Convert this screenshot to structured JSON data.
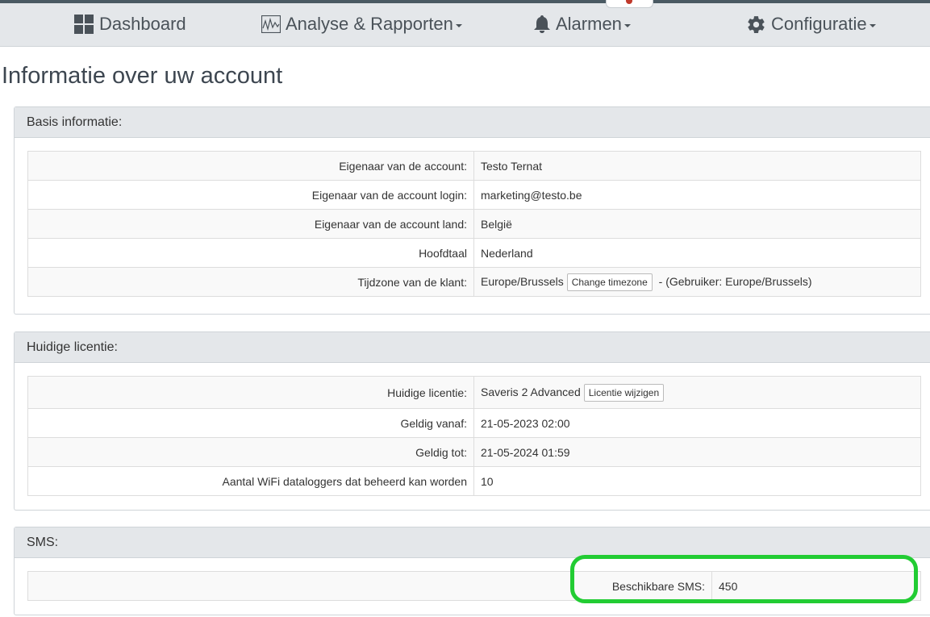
{
  "nav": {
    "dashboard": "Dashboard",
    "analyse": "Analyse & Rapporten",
    "alarmen": "Alarmen",
    "configuratie": "Configuratie"
  },
  "page_title": "Informatie over uw account",
  "basis": {
    "heading": "Basis informatie:",
    "rows": [
      {
        "label": "Eigenaar van de account:",
        "value": "Testo Ternat"
      },
      {
        "label": "Eigenaar van de account login:",
        "value": "marketing@testo.be"
      },
      {
        "label": "Eigenaar van de account land:",
        "value": "België"
      },
      {
        "label": "Hoofdtaal",
        "value": "Nederland"
      },
      {
        "label": "Tijdzone van de klant:",
        "value": "Europe/Brussels",
        "button": "Change timezone",
        "suffix": "- (Gebruiker: Europe/Brussels)"
      }
    ]
  },
  "licentie": {
    "heading": "Huidige licentie:",
    "rows": [
      {
        "label": "Huidige licentie:",
        "value": "Saveris 2 Advanced",
        "button": "Licentie wijzigen"
      },
      {
        "label": "Geldig vanaf:",
        "value": "21-05-2023 02:00"
      },
      {
        "label": "Geldig tot:",
        "value": "21-05-2024 01:59"
      },
      {
        "label": "Aantal WiFi dataloggers dat beheerd kan worden",
        "value": "10"
      }
    ]
  },
  "sms": {
    "heading": "SMS:",
    "label": "Beschikbare SMS:",
    "value": "450"
  },
  "colors": {
    "navbar_bg": "#e4e7ea",
    "highlight": "#22cc33",
    "text": "#333333"
  },
  "icons": [
    "dashboard-grid-icon",
    "chart-icon",
    "bell-icon",
    "gear-icon"
  ]
}
